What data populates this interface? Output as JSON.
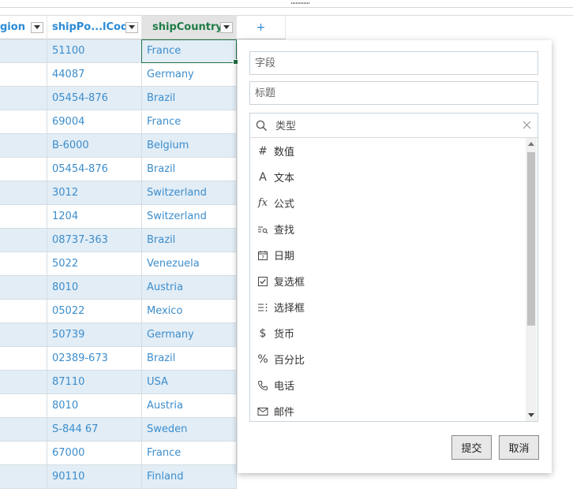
{
  "header": {
    "col0": "gion",
    "col1": "shipPo...lCode",
    "col2": "shipCountry",
    "add": "+"
  },
  "rows": [
    {
      "code": "51100",
      "country": "France"
    },
    {
      "code": "44087",
      "country": "Germany"
    },
    {
      "code": "05454-876",
      "country": "Brazil"
    },
    {
      "code": "69004",
      "country": "France"
    },
    {
      "code": "B-6000",
      "country": "Belgium"
    },
    {
      "code": "05454-876",
      "country": "Brazil"
    },
    {
      "code": "3012",
      "country": "Switzerland"
    },
    {
      "code": "1204",
      "country": "Switzerland"
    },
    {
      "code": "08737-363",
      "country": "Brazil"
    },
    {
      "code": "5022",
      "country": "Venezuela"
    },
    {
      "code": "8010",
      "country": "Austria"
    },
    {
      "code": "05022",
      "country": "Mexico"
    },
    {
      "code": "50739",
      "country": "Germany"
    },
    {
      "code": "02389-673",
      "country": "Brazil"
    },
    {
      "code": "87110",
      "country": "USA"
    },
    {
      "code": "8010",
      "country": "Austria"
    },
    {
      "code": "S-844 67",
      "country": "Sweden"
    },
    {
      "code": "67000",
      "country": "France"
    },
    {
      "code": "90110",
      "country": "Finland"
    }
  ],
  "panel": {
    "field_placeholder": "字段",
    "title_placeholder": "标题",
    "type_search_placeholder": "类型",
    "types": [
      {
        "icon_name": "hash-icon",
        "icon": "#",
        "label": "数值"
      },
      {
        "icon_name": "text-icon",
        "icon": "A",
        "label": "文本"
      },
      {
        "icon_name": "formula-icon",
        "icon": "fx",
        "label": "公式"
      },
      {
        "icon_name": "lookup-icon",
        "icon": "lookup",
        "label": "查找"
      },
      {
        "icon_name": "calendar-icon",
        "icon": "cal",
        "label": "日期"
      },
      {
        "icon_name": "checkbox-icon",
        "icon": "check",
        "label": "复选框"
      },
      {
        "icon_name": "list-icon",
        "icon": "list",
        "label": "选择框"
      },
      {
        "icon_name": "dollar-icon",
        "icon": "$",
        "label": "货币"
      },
      {
        "icon_name": "percent-icon",
        "icon": "%",
        "label": "百分比"
      },
      {
        "icon_name": "phone-icon",
        "icon": "phone",
        "label": "电话"
      },
      {
        "icon_name": "mail-icon",
        "icon": "mail",
        "label": "邮件"
      }
    ],
    "submit_label": "提交",
    "cancel_label": "取消"
  },
  "colors": {
    "accent_text": "#3c8dcc",
    "alt_row": "#e2edf6",
    "active_header": "#1e7c46"
  }
}
